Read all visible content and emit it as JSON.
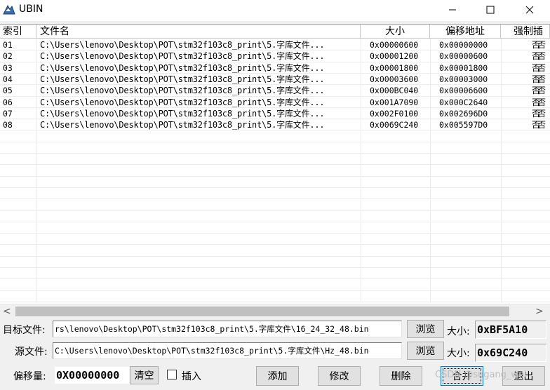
{
  "window": {
    "title": "UBIN",
    "minimize_glyph": "—",
    "close_glyph": "✕"
  },
  "columns": [
    "索引",
    "文件名",
    "大小",
    "偏移地址",
    "强制插"
  ],
  "rows": [
    {
      "index": "01",
      "file": "C:\\Users\\lenovo\\Desktop\\POT\\stm32f103c8_print\\5.字库文件...",
      "size": "0x00000600",
      "offset": "0x00000000",
      "force": "否否"
    },
    {
      "index": "02",
      "file": "C:\\Users\\lenovo\\Desktop\\POT\\stm32f103c8_print\\5.字库文件...",
      "size": "0x00001200",
      "offset": "0x00000600",
      "force": "否否"
    },
    {
      "index": "03",
      "file": "C:\\Users\\lenovo\\Desktop\\POT\\stm32f103c8_print\\5.字库文件...",
      "size": "0x00001800",
      "offset": "0x00001800",
      "force": "否否"
    },
    {
      "index": "04",
      "file": "C:\\Users\\lenovo\\Desktop\\POT\\stm32f103c8_print\\5.字库文件...",
      "size": "0x00003600",
      "offset": "0x00003000",
      "force": "否否"
    },
    {
      "index": "05",
      "file": "C:\\Users\\lenovo\\Desktop\\POT\\stm32f103c8_print\\5.字库文件...",
      "size": "0x000BC040",
      "offset": "0x00006600",
      "force": "否否"
    },
    {
      "index": "06",
      "file": "C:\\Users\\lenovo\\Desktop\\POT\\stm32f103c8_print\\5.字库文件...",
      "size": "0x001A7090",
      "offset": "0x000C2640",
      "force": "否否"
    },
    {
      "index": "07",
      "file": "C:\\Users\\lenovo\\Desktop\\POT\\stm32f103c8_print\\5.字库文件...",
      "size": "0x002F0100",
      "offset": "0x002696D0",
      "force": "否否"
    },
    {
      "index": "08",
      "file": "C:\\Users\\lenovo\\Desktop\\POT\\stm32f103c8_print\\5.字库文件...",
      "size": "0x0069C240",
      "offset": "0x005597D0",
      "force": "否否"
    }
  ],
  "scrollbar": {
    "left_glyph": "<",
    "right_glyph": ">"
  },
  "target": {
    "label": "目标文件:",
    "value": "rs\\lenovo\\Desktop\\POT\\stm32f103c8_print\\5.字库文件\\16_24_32_48.bin",
    "browse_label": "浏览",
    "size_label": "大小:",
    "size_value": "0xBF5A10"
  },
  "source": {
    "label": "源文件:",
    "value": "C:\\Users\\lenovo\\Desktop\\POT\\stm32f103c8_print\\5.字库文件\\Hz_48.bin",
    "browse_label": "浏览",
    "size_label": "大小:",
    "size_value": "0x69C240"
  },
  "offset": {
    "label": "偏移量:",
    "value": "0X00000000",
    "clear_label": "清空",
    "insert_label": "插入"
  },
  "actions": {
    "add": "添加",
    "modify": "修改",
    "delete": "删除",
    "merge": "合并",
    "exit": "退出"
  },
  "watermark": "CSDN @sugang_wei"
}
